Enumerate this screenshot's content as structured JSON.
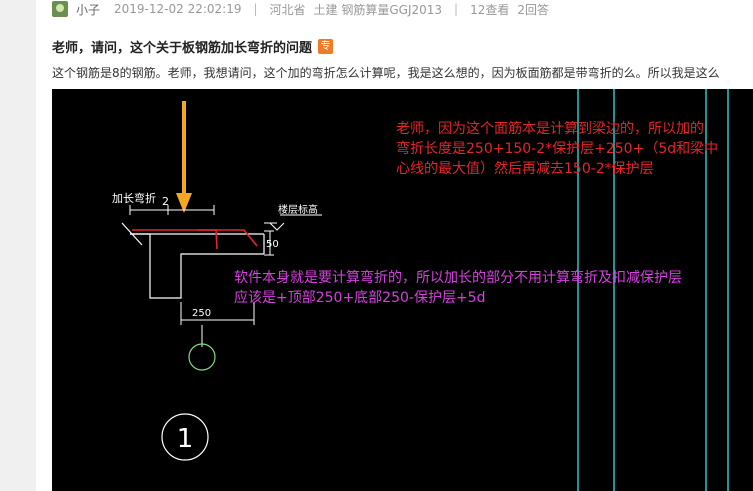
{
  "post": {
    "user": "小子",
    "datetime": "2019-12-02 22:02:19",
    "region": "河北省",
    "category": "土建 钢筋算量GGJ2013",
    "views": "12查看",
    "answers": "2回答"
  },
  "question": {
    "title": "老师，请问，这个关于板钢筋加长弯折的问题",
    "badge": "专",
    "description": "这个钢筋是8的钢筋。老师，我想请问，这个加的弯折怎么计算呢，我是这么想的，因为板面筋都是带弯折的么。所以我是这么"
  },
  "cad": {
    "labels": {
      "extension": "加长弯折",
      "two_mark": "2",
      "floor_level": "楼层标高",
      "dim_top": "50",
      "dim_bottom": "250",
      "axis_number": "1"
    },
    "red_note": [
      "老师，因为这个面筋本是计算到梁边的，所以加的",
      "弯折长度是250+150-2*保护层+250+（5d和梁中",
      "心线的最大值）然后再减去150-2*保护层"
    ],
    "magenta_note": [
      "软件本身就是要计算弯折的，所以加长的部分不用计算弯折及扣减保护层",
      "应该是+顶部250+底部250-保护层+5d"
    ],
    "colors": {
      "background": "#000000",
      "lines": "#ffffff",
      "rebar": "#e2262a",
      "arrow": "#f5a623",
      "cyan_lines": "#28c8c8",
      "green_dim": "#7fdc7f",
      "red_text": "#e2262a",
      "magenta_text": "#d640e0"
    }
  }
}
